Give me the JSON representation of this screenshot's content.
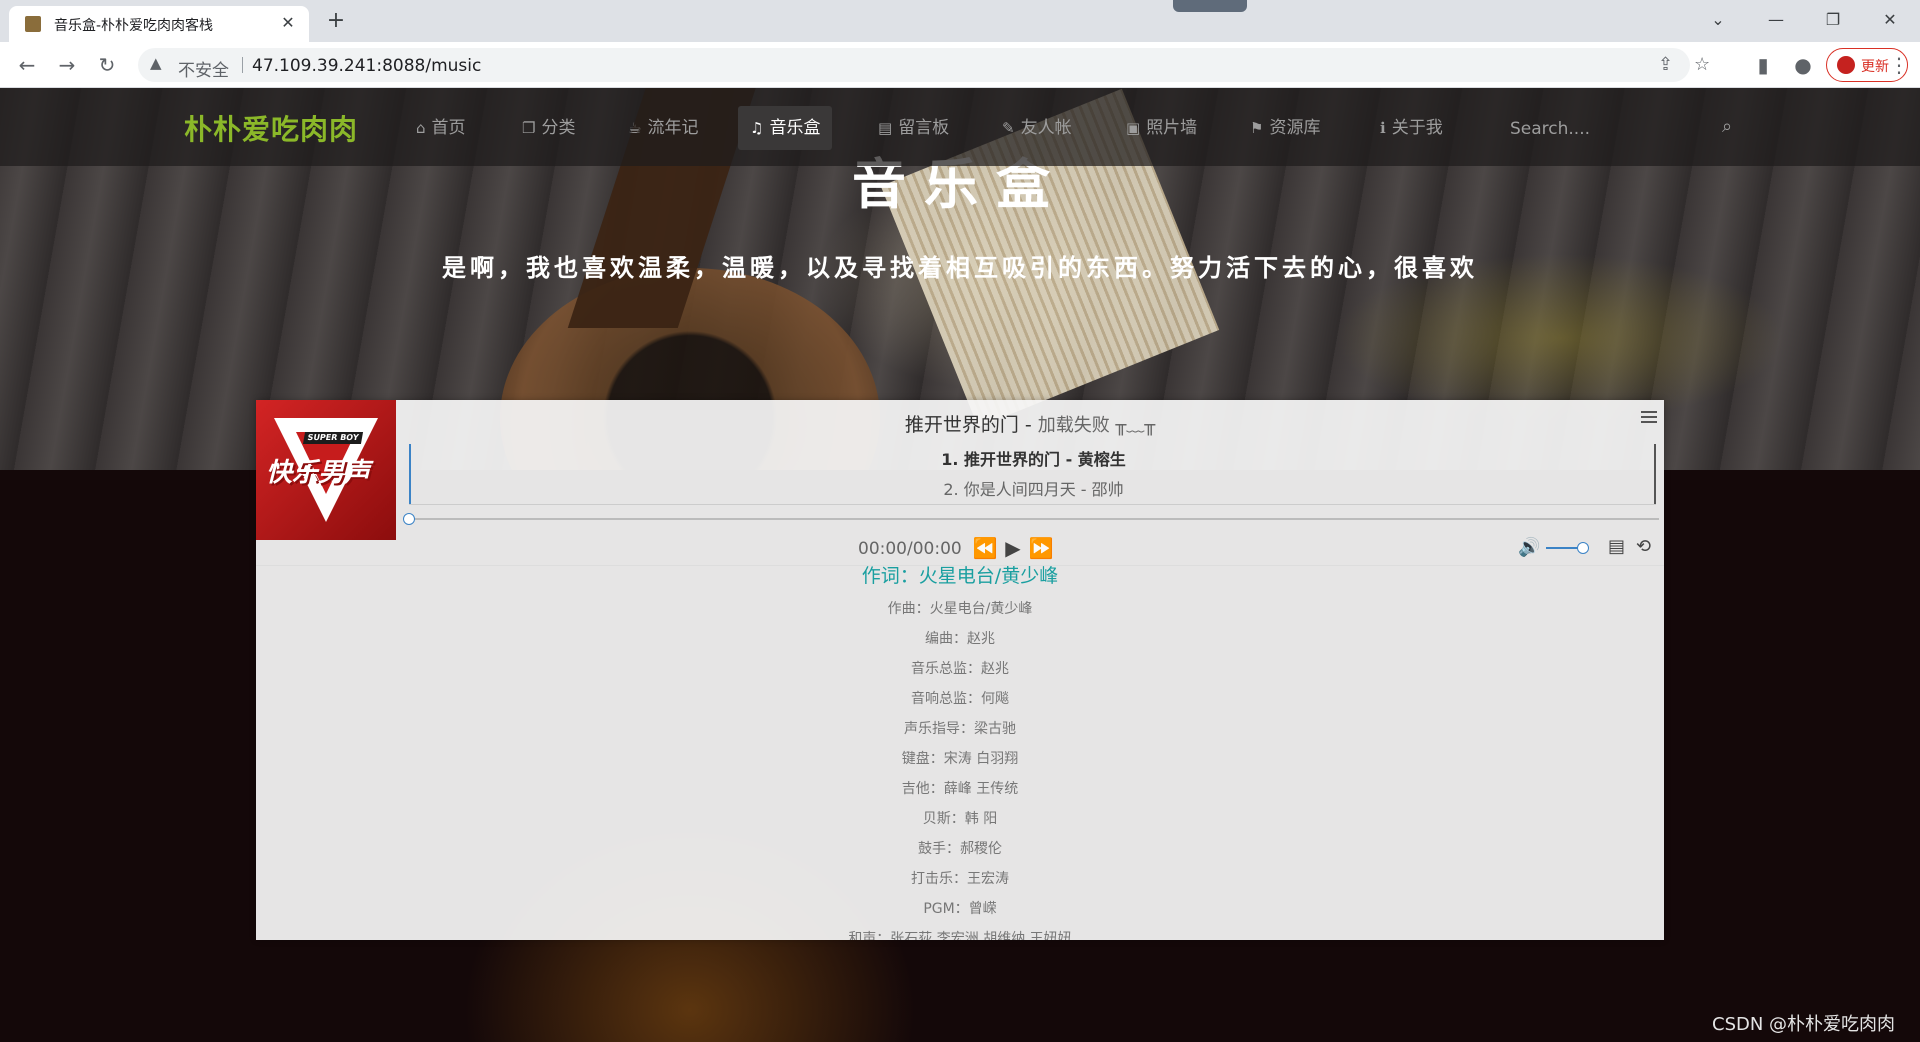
{
  "browser": {
    "tab_title": "音乐盒-朴朴爱吃肉肉客栈",
    "new_tab": "+",
    "tab_close": "✕",
    "security_label": "不安全",
    "url": "47.109.39.241:8088/music",
    "update_label": "更新"
  },
  "site": {
    "brand": "朴朴爱吃肉肉",
    "nav": [
      {
        "icon": "home-icon",
        "glyph": "⌂",
        "label": "首页"
      },
      {
        "icon": "copy-icon",
        "glyph": "❐",
        "label": "分类"
      },
      {
        "icon": "cup-icon",
        "glyph": "☕",
        "label": "流年记"
      },
      {
        "icon": "music-icon",
        "glyph": "♫",
        "label": "音乐盒"
      },
      {
        "icon": "book-icon",
        "glyph": "▤",
        "label": "留言板"
      },
      {
        "icon": "pencil-icon",
        "glyph": "✎",
        "label": "友人帐"
      },
      {
        "icon": "picture-icon",
        "glyph": "▣",
        "label": "照片墙"
      },
      {
        "icon": "graduation-cap-icon",
        "glyph": "⚑",
        "label": "资源库"
      },
      {
        "icon": "info-icon",
        "glyph": "ℹ",
        "label": "关于我"
      }
    ],
    "active_nav": "音乐盒",
    "search_placeholder": "Search...."
  },
  "hero": {
    "title": "音乐盒",
    "subtitle": "是啊，我也喜欢温柔，温暖，以及寻找着相互吸引的东西。努力活下去的心，很喜欢"
  },
  "player": {
    "cover_badge": "SUPER BOY",
    "cover_text": "快乐男声",
    "title": "推开世界的门",
    "title_sep": " - ",
    "error": "加载失败 ╥﹏╥",
    "playlist": [
      {
        "index": "1.",
        "title": "推开世界的门",
        "artist": "黄榕生"
      },
      {
        "index": "2.",
        "title": "你是人间四月天",
        "artist": "邵帅"
      }
    ],
    "time": "00:00/00:00",
    "progress": 0,
    "volume": 0.8,
    "lyrics": {
      "current": "作词：火星电台/黄少峰",
      "lines": [
        "作曲：火星电台/黄少峰",
        "编曲：赵兆",
        "音乐总监：赵兆",
        "音响总监：何飚",
        "声乐指导：梁古驰",
        "键盘：宋涛 白羽翔",
        "吉他：薛峰 王传统",
        "贝斯：韩 阳",
        "鼓手：郝稷伦",
        "打击乐：王宏涛",
        "PGM：曾嵘",
        "和声：张石荻 李宏洲 胡维纳 王妞妞"
      ]
    }
  },
  "watermark": "CSDN @朴朴爱吃肉肉"
}
